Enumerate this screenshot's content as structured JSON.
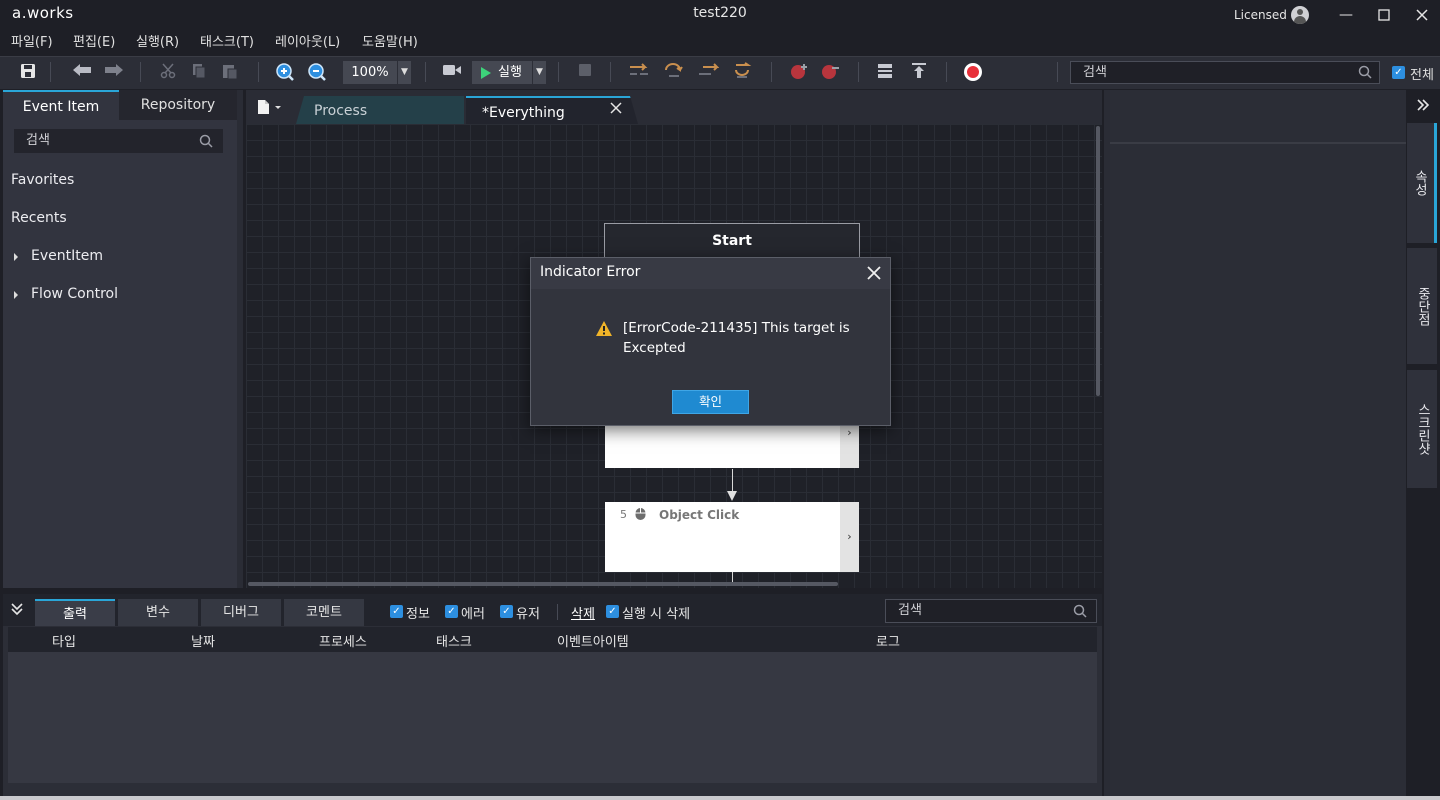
{
  "app": {
    "logo": "a.works",
    "window_title": "test220",
    "license_label": "Licensed"
  },
  "menu": [
    "파일(F)",
    "편집(E)",
    "실행(R)",
    "태스크(T)",
    "레이아웃(L)",
    "도움말(H)"
  ],
  "toolbar": {
    "zoom": "100%",
    "run_label": "실행",
    "search_placeholder": "검색",
    "all_label": "전체",
    "all_checked": true
  },
  "left_panel": {
    "tabs": [
      "Event Item",
      "Repository"
    ],
    "active_tab": "Event Item",
    "search_placeholder": "검색",
    "items": [
      {
        "label": "Favorites",
        "expandable": false
      },
      {
        "label": "Recents",
        "expandable": false
      },
      {
        "label": "EventItem",
        "expandable": true
      },
      {
        "label": "Flow Control",
        "expandable": true
      }
    ]
  },
  "editor": {
    "tabs": [
      {
        "label": "Process",
        "active": false
      },
      {
        "label": "*Everything",
        "active": true
      }
    ],
    "nodes": {
      "start_label": "Start",
      "node5_number": "5",
      "node5_label": "Object Click"
    }
  },
  "dialog": {
    "title": "Indicator Error",
    "message": "[ErrorCode-211435] This target is Excepted",
    "ok_label": "확인"
  },
  "right_sidebar": {
    "tabs": [
      "속성",
      "중단점",
      "스크린샷"
    ]
  },
  "bottom_panel": {
    "tabs": [
      "출력",
      "변수",
      "디버그",
      "코멘트"
    ],
    "filters": [
      {
        "label": "정보",
        "checked": true
      },
      {
        "label": "에러",
        "checked": true
      },
      {
        "label": "유저",
        "checked": true
      }
    ],
    "clear_label": "삭제",
    "clear_on_run_label": "실행 시 삭제",
    "search_placeholder": "검색",
    "columns": [
      "타입",
      "날짜",
      "프로세스",
      "태스크",
      "이벤트아이템",
      "로그"
    ]
  },
  "colors": {
    "accent": "#2aa6d8",
    "run_green": "#3dd27a",
    "record_red": "#e8303a",
    "checkbox_blue": "#2d8fe0",
    "warning_yellow": "#f0b429",
    "ok_button": "#1f8ad1"
  }
}
